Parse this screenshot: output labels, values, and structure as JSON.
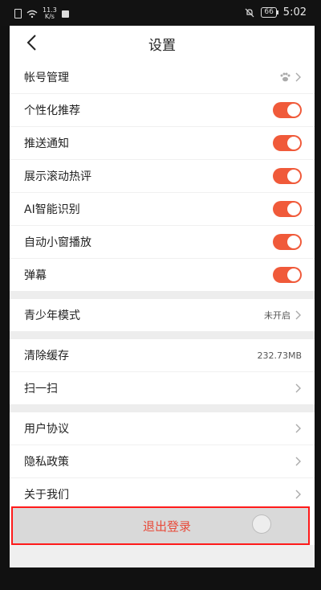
{
  "status_bar": {
    "speed_value": "11.3",
    "speed_unit": "K/s",
    "battery": "66",
    "time": "5:02"
  },
  "header": {
    "title": "设置"
  },
  "section1": [
    {
      "label": "帐号管理",
      "control": "chevron",
      "icon": "paw-icon"
    },
    {
      "label": "个性化推荐",
      "control": "toggle",
      "on": true
    },
    {
      "label": "推送通知",
      "control": "toggle",
      "on": true
    },
    {
      "label": "展示滚动热评",
      "control": "toggle",
      "on": true
    },
    {
      "label": "AI智能识别",
      "control": "toggle",
      "on": true
    },
    {
      "label": "自动小窗播放",
      "control": "toggle",
      "on": true
    },
    {
      "label": "弹幕",
      "control": "toggle",
      "on": true
    }
  ],
  "section2": {
    "youth_mode": {
      "label": "青少年模式",
      "value": "未开启"
    }
  },
  "section3": {
    "clear_cache": {
      "label": "清除缓存",
      "value": "232.73MB"
    },
    "scan": {
      "label": "扫一扫"
    }
  },
  "section4": [
    {
      "label": "用户协议"
    },
    {
      "label": "隐私政策"
    },
    {
      "label": "关于我们"
    }
  ],
  "logout": {
    "label": "退出登录"
  },
  "colors": {
    "accent": "#f05a3a",
    "logout_text": "#e84b3a",
    "highlight_border": "#ff1a1a"
  }
}
